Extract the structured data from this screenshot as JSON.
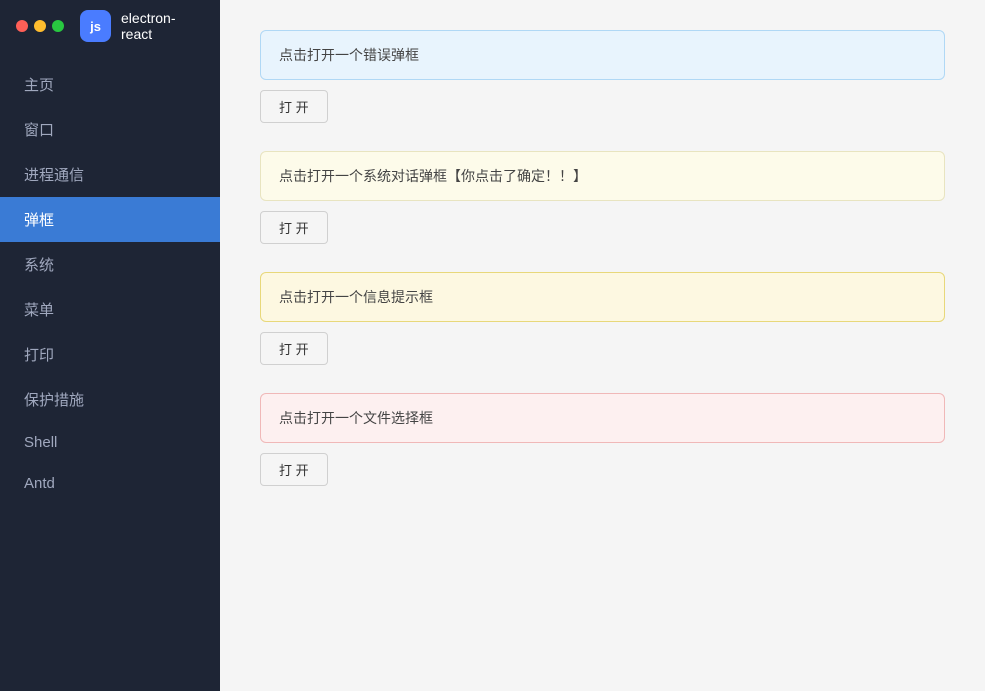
{
  "app": {
    "title": "electron-react",
    "icon_label": "⬡"
  },
  "traffic_lights": {
    "close": "close",
    "minimize": "minimize",
    "maximize": "maximize"
  },
  "sidebar": {
    "items": [
      {
        "id": "home",
        "label": "主页",
        "active": false
      },
      {
        "id": "window",
        "label": "窗口",
        "active": false
      },
      {
        "id": "ipc",
        "label": "进程通信",
        "active": false
      },
      {
        "id": "dialog",
        "label": "弹框",
        "active": true
      },
      {
        "id": "system",
        "label": "系统",
        "active": false
      },
      {
        "id": "menu",
        "label": "菜单",
        "active": false
      },
      {
        "id": "print",
        "label": "打印",
        "active": false
      },
      {
        "id": "security",
        "label": "保护措施",
        "active": false
      },
      {
        "id": "shell",
        "label": "Shell",
        "active": false
      },
      {
        "id": "antd",
        "label": "Antd",
        "active": false
      }
    ]
  },
  "main": {
    "dialogs": [
      {
        "id": "error",
        "display_text": "点击打开一个错误弹框",
        "button_label": "打 开",
        "style": "blue"
      },
      {
        "id": "system",
        "display_text": "点击打开一个系统对话弹框【你点击了确定！！】",
        "button_label": "打 开",
        "style": "yellow-light"
      },
      {
        "id": "info",
        "display_text": "点击打开一个信息提示框",
        "button_label": "打 开",
        "style": "orange"
      },
      {
        "id": "file",
        "display_text": "点击打开一个文件选择框",
        "button_label": "打 开",
        "style": "pink"
      }
    ]
  }
}
